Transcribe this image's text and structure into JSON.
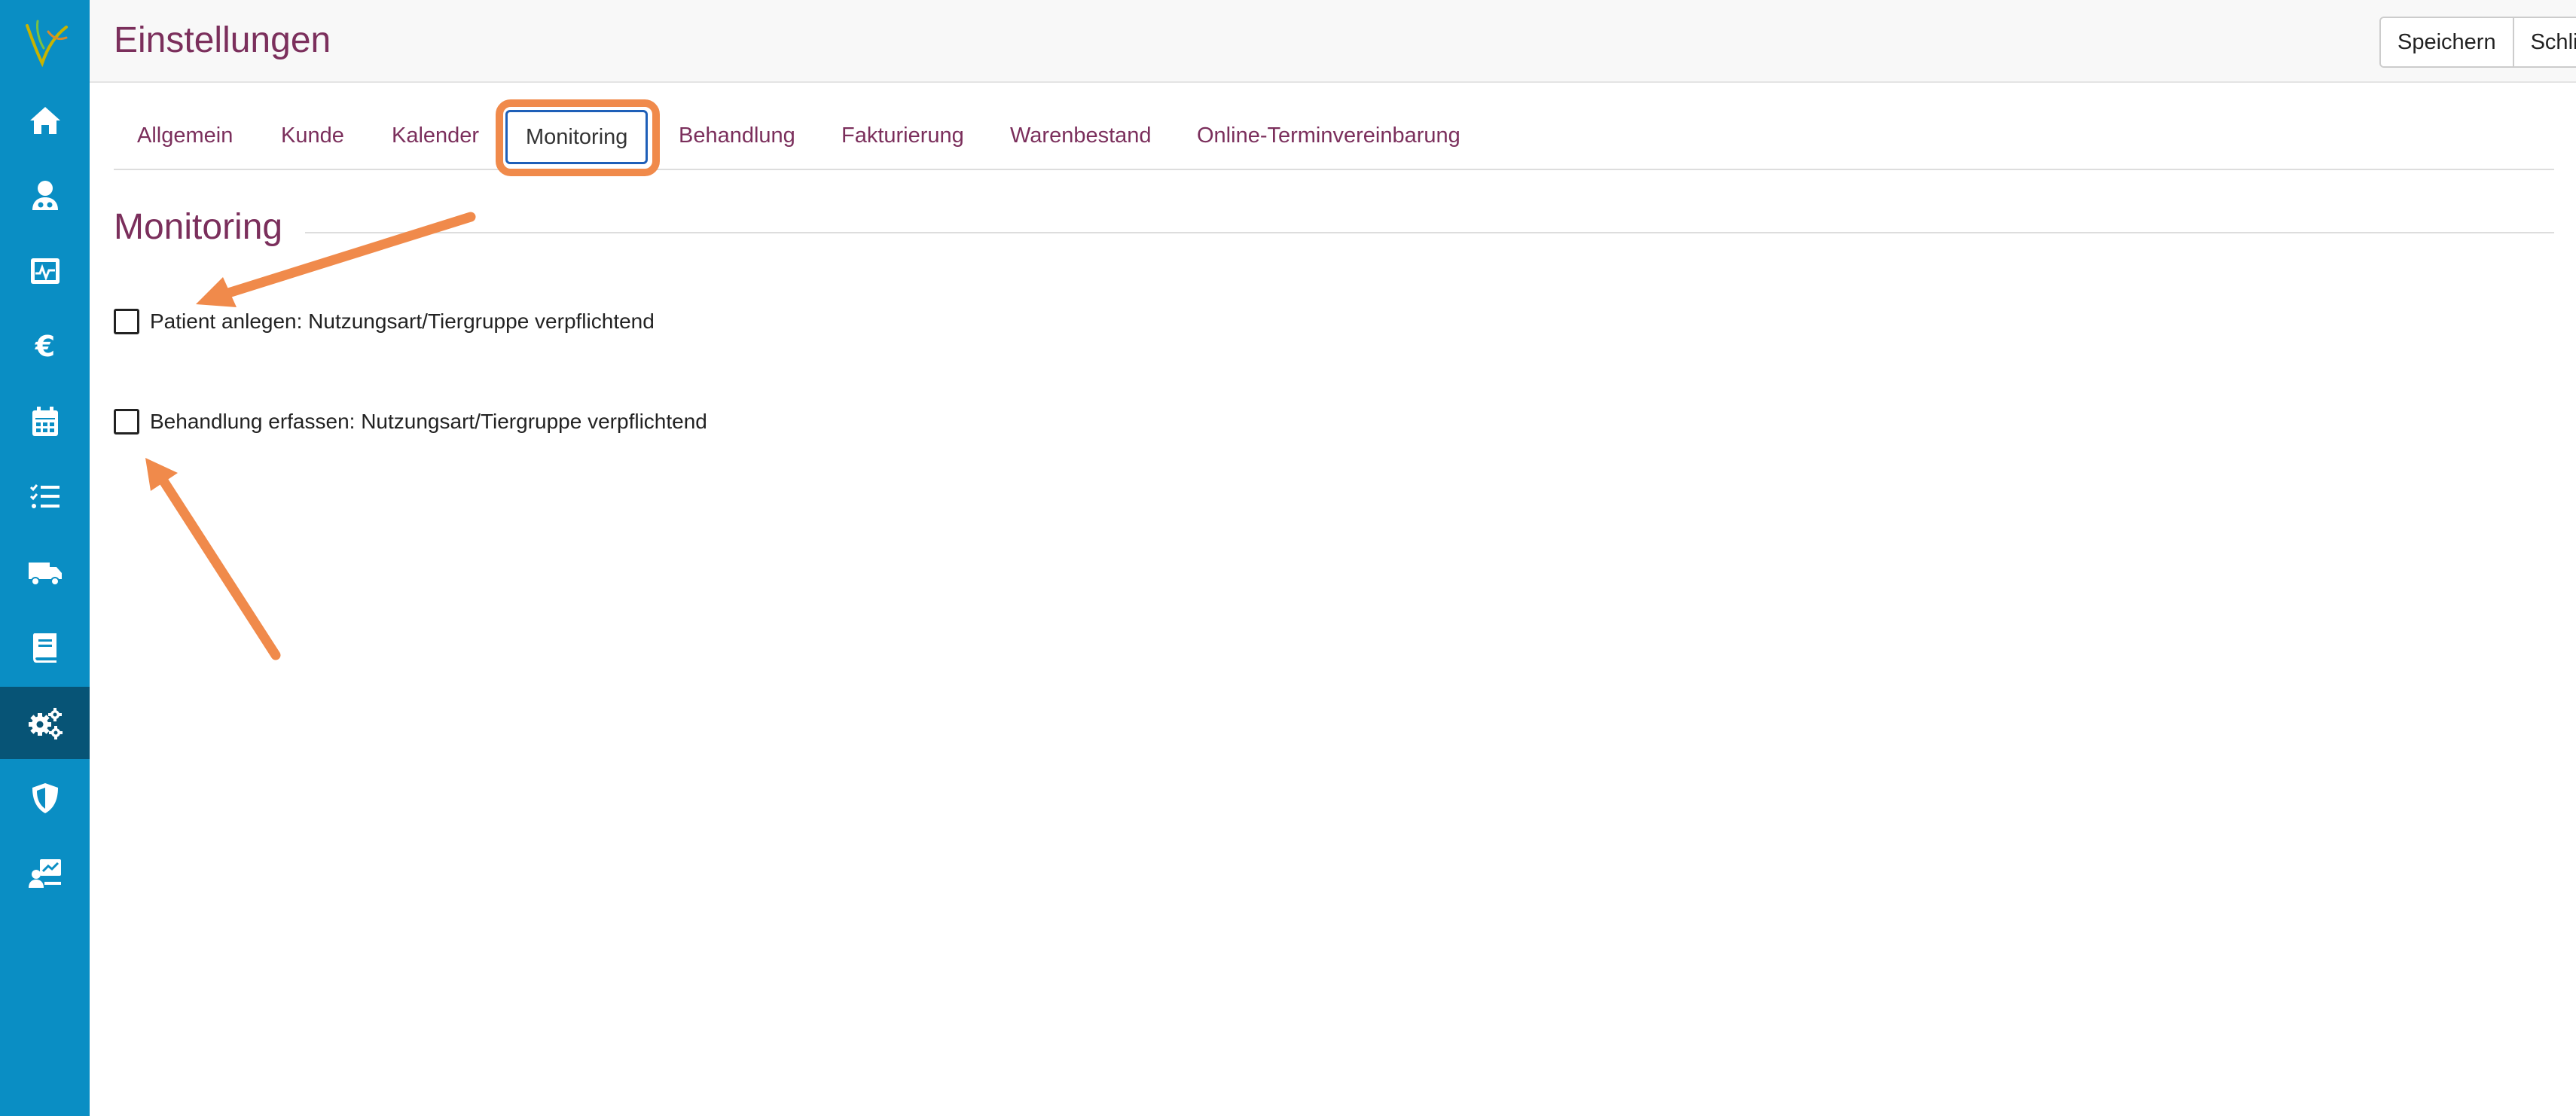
{
  "header": {
    "title": "Einstellungen",
    "save_label": "Speichern",
    "close_label": "Schließen"
  },
  "sidebar": {
    "logo": "app-logo",
    "items": [
      {
        "icon": "home-icon",
        "active": false
      },
      {
        "icon": "user-doctor-icon",
        "active": false
      },
      {
        "icon": "image-monitor-icon",
        "active": false
      },
      {
        "icon": "euro-icon",
        "active": false
      },
      {
        "icon": "calendar-icon",
        "active": false
      },
      {
        "icon": "checklist-icon",
        "active": false
      },
      {
        "icon": "truck-icon",
        "active": false
      },
      {
        "icon": "book-icon",
        "active": false
      },
      {
        "icon": "gears-icon",
        "active": true
      },
      {
        "icon": "shield-icon",
        "active": false
      },
      {
        "icon": "user-chart-icon",
        "active": false
      }
    ]
  },
  "tabs": [
    {
      "label": "Allgemein",
      "active": false
    },
    {
      "label": "Kunde",
      "active": false
    },
    {
      "label": "Kalender",
      "active": false
    },
    {
      "label": "Monitoring",
      "active": true
    },
    {
      "label": "Behandlung",
      "active": false
    },
    {
      "label": "Fakturierung",
      "active": false
    },
    {
      "label": "Warenbestand",
      "active": false
    },
    {
      "label": "Online-Terminvereinbarung",
      "active": false
    }
  ],
  "section": {
    "title": "Monitoring",
    "options": [
      {
        "label": "Patient anlegen: Nutzungsart/Tiergruppe verpflichtend",
        "checked": false
      },
      {
        "label": "Behandlung erfassen: Nutzungsart/Tiergruppe verpflichtend",
        "checked": false
      }
    ]
  },
  "colors": {
    "sidebar": "#0a8ec4",
    "sidebar_active": "#075476",
    "title": "#7b2f5c",
    "annotation": "#f08a4b",
    "active_tab_border": "#1e5fb8"
  }
}
